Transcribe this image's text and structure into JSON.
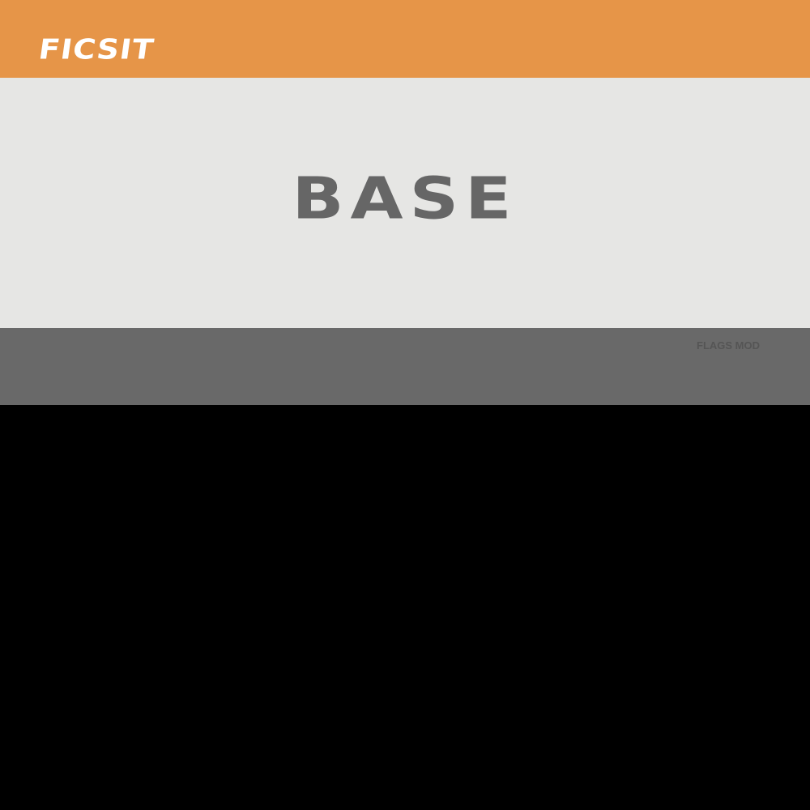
{
  "header": {
    "logo_text": "FICSIT",
    "background_color": "#E69548"
  },
  "main": {
    "title": "BASE",
    "background_color": "#E6E6E4",
    "title_color": "#666666"
  },
  "footer": {
    "label": "FLAGS MOD",
    "background_color": "#696969"
  },
  "lower_area": {
    "background_color": "#000000"
  }
}
